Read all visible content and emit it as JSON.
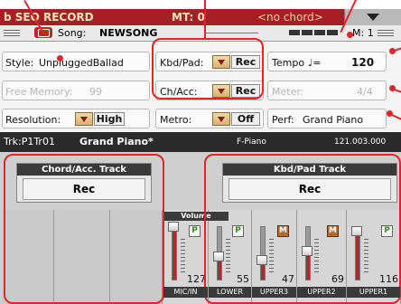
{
  "title_bar": {
    "mode": "b SEQ RECORD",
    "meter": "MT: 0",
    "chord": "<no chord>"
  },
  "song_bar": {
    "song_label": "Song:",
    "song_name": "NEWSONG",
    "measure": "M: 1"
  },
  "params": {
    "style_label": "Style:",
    "style_value": "UnpluggedBallad",
    "free_memory_label": "Free Memory:",
    "free_memory_value": "99",
    "resolution_label": "Resolution:",
    "resolution_value": "High",
    "kbd_pad_label": "Kbd/Pad:",
    "kbd_pad_value": "Rec",
    "ch_acc_label": "Ch/Acc:",
    "ch_acc_value": "Rec",
    "metro_label": "Metro:",
    "metro_value": "Off",
    "tempo_label": "Tempo",
    "tempo_note": "♩=",
    "tempo_value": "120",
    "meter_label": "Meter:",
    "meter_value": "4/4",
    "perf_label": "Perf:",
    "perf_value": "Grand Piano"
  },
  "track_info": {
    "track": "Trk:P1Tr01",
    "sound": "Grand Piano*",
    "family": "F-Piano",
    "bank": "121.003.000"
  },
  "tracks": {
    "chord_acc_title": "Chord/Acc. Track",
    "chord_acc_value": "Rec",
    "kbd_pad_title": "Kbd/Pad Track",
    "kbd_pad_value": "Rec"
  },
  "mixer": {
    "volume_label": "Volume",
    "channels": [
      {
        "name": "MIC/IN",
        "value": "127",
        "level": 1.0,
        "button": "P"
      },
      {
        "name": "LOWER",
        "value": "55",
        "level": 0.43,
        "button": "P"
      },
      {
        "name": "UPPER3",
        "value": "47",
        "level": 0.37,
        "button": "M"
      },
      {
        "name": "UPPER2",
        "value": "69",
        "level": 0.54,
        "button": "M"
      },
      {
        "name": "UPPER1",
        "value": "116",
        "level": 0.91,
        "button": "P"
      }
    ]
  },
  "colors": {
    "title_red": "#a51f25",
    "callout_red": "#e0252b",
    "slider_fill": "#a0312e"
  }
}
